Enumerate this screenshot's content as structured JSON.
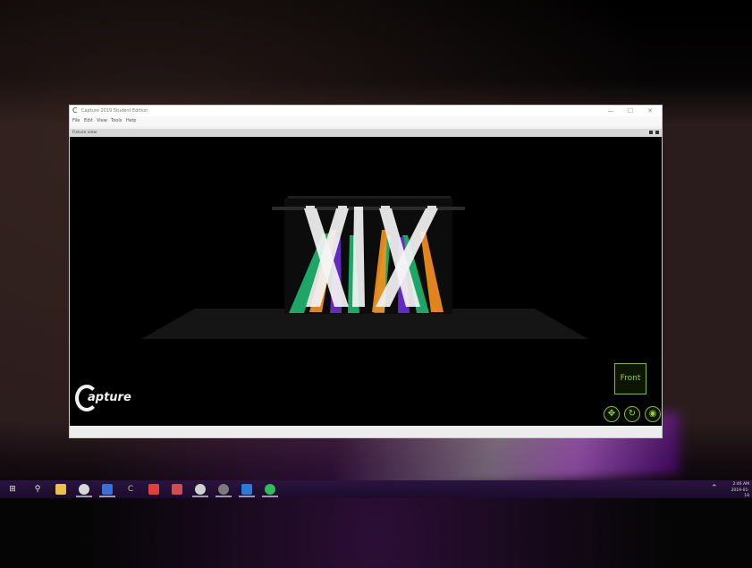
{
  "window": {
    "title": "Capture 2019 Student Edition",
    "min_glyph": "—",
    "max_glyph": "☐",
    "close_glyph": "✕"
  },
  "menu": [
    "File",
    "Edit",
    "View",
    "Tools",
    "Help"
  ],
  "panel": {
    "title": "Fixture view"
  },
  "viewport": {
    "logo_text": "apture",
    "view_button": "Front",
    "nav_icons": [
      "move-icon",
      "rotate-icon",
      "zoom-icon"
    ],
    "beam_colors": {
      "white": "#f4f4f4",
      "orange": "#f2901e",
      "green": "#1fb46f",
      "purple": "#6a2fd0"
    }
  },
  "taskbar": {
    "icons": [
      "windows-icon",
      "search-icon",
      "file-explorer-icon",
      "chrome-icon",
      "app-icon",
      "capture-icon",
      "folder-icon",
      "app-icon",
      "app-icon",
      "app-icon",
      "app-icon",
      "spotify-icon"
    ],
    "time": "2:46 AM",
    "date": "2019-01-18"
  },
  "accent_color": "#86b82e"
}
